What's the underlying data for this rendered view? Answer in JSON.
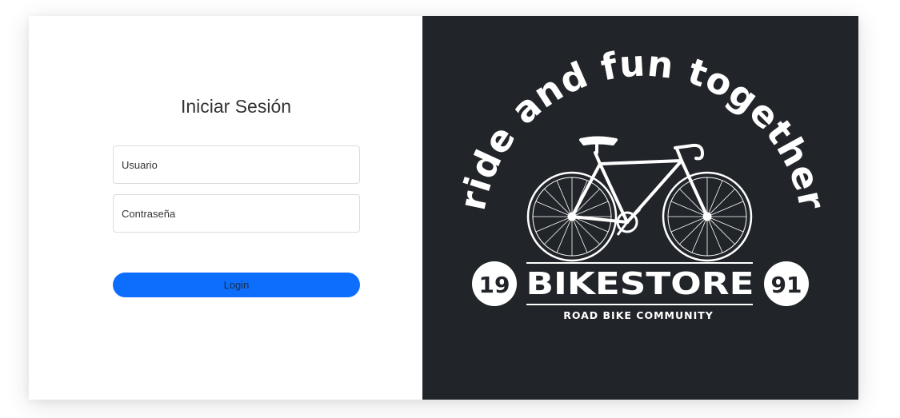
{
  "login": {
    "title": "Iniciar Sesión",
    "username_placeholder": "Usuario",
    "password_placeholder": "Contraseña",
    "button_label": "Login"
  },
  "brand": {
    "arc_text": "ride and fun together",
    "year_left": "19",
    "year_right": "91",
    "name": "BIKESTORE",
    "tagline": "ROAD BIKE COMMUNITY",
    "icon": "bicycle-icon"
  },
  "colors": {
    "accent": "#0d6efd",
    "panel_dark": "#212529"
  }
}
